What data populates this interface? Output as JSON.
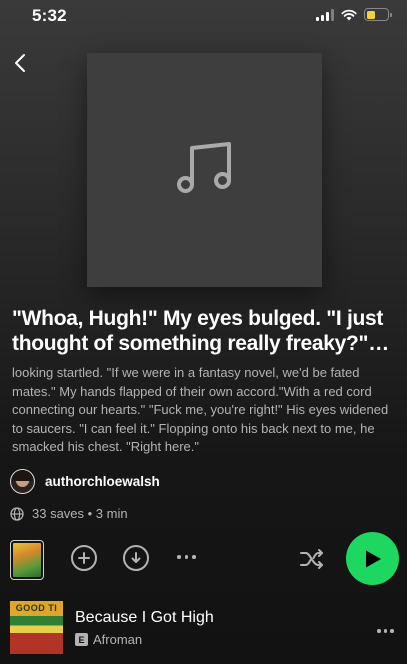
{
  "status_bar": {
    "time": "5:32",
    "battery_level": 0.4,
    "battery_color": "#f4d03f"
  },
  "episode": {
    "title": "\"Whoa, Hugh!\" My eyes bulged. \"I just thought of something really freaky?\" \"...",
    "description": "looking startled. \"If we were in a fantasy novel, we'd be fated mates.\" My hands flapped of their own accord.\"With a red cord connecting our hearts.\"  \"Fuck me, you're right!\" His eyes widened to saucers. \"I can feel it.\" Flopping onto his back next to me, he smacked his chest.  \"Right here.\"",
    "cover_icon": "music-note-icon"
  },
  "author": {
    "name": "authorchloewalsh"
  },
  "meta": {
    "saves_text": "33 saves • 3 min",
    "icon": "globe-icon"
  },
  "actions": {
    "add_icon": "plus-circle-icon",
    "download_icon": "download-icon",
    "more_icon": "more-dots-icon",
    "shuffle_icon": "shuffle-icon",
    "play_icon": "play-icon",
    "accent": "#1ed760"
  },
  "tracks": [
    {
      "title": "Because I Got High",
      "artist": "Afroman",
      "explicit_label": "E",
      "art_text": "GOOD TI"
    }
  ]
}
